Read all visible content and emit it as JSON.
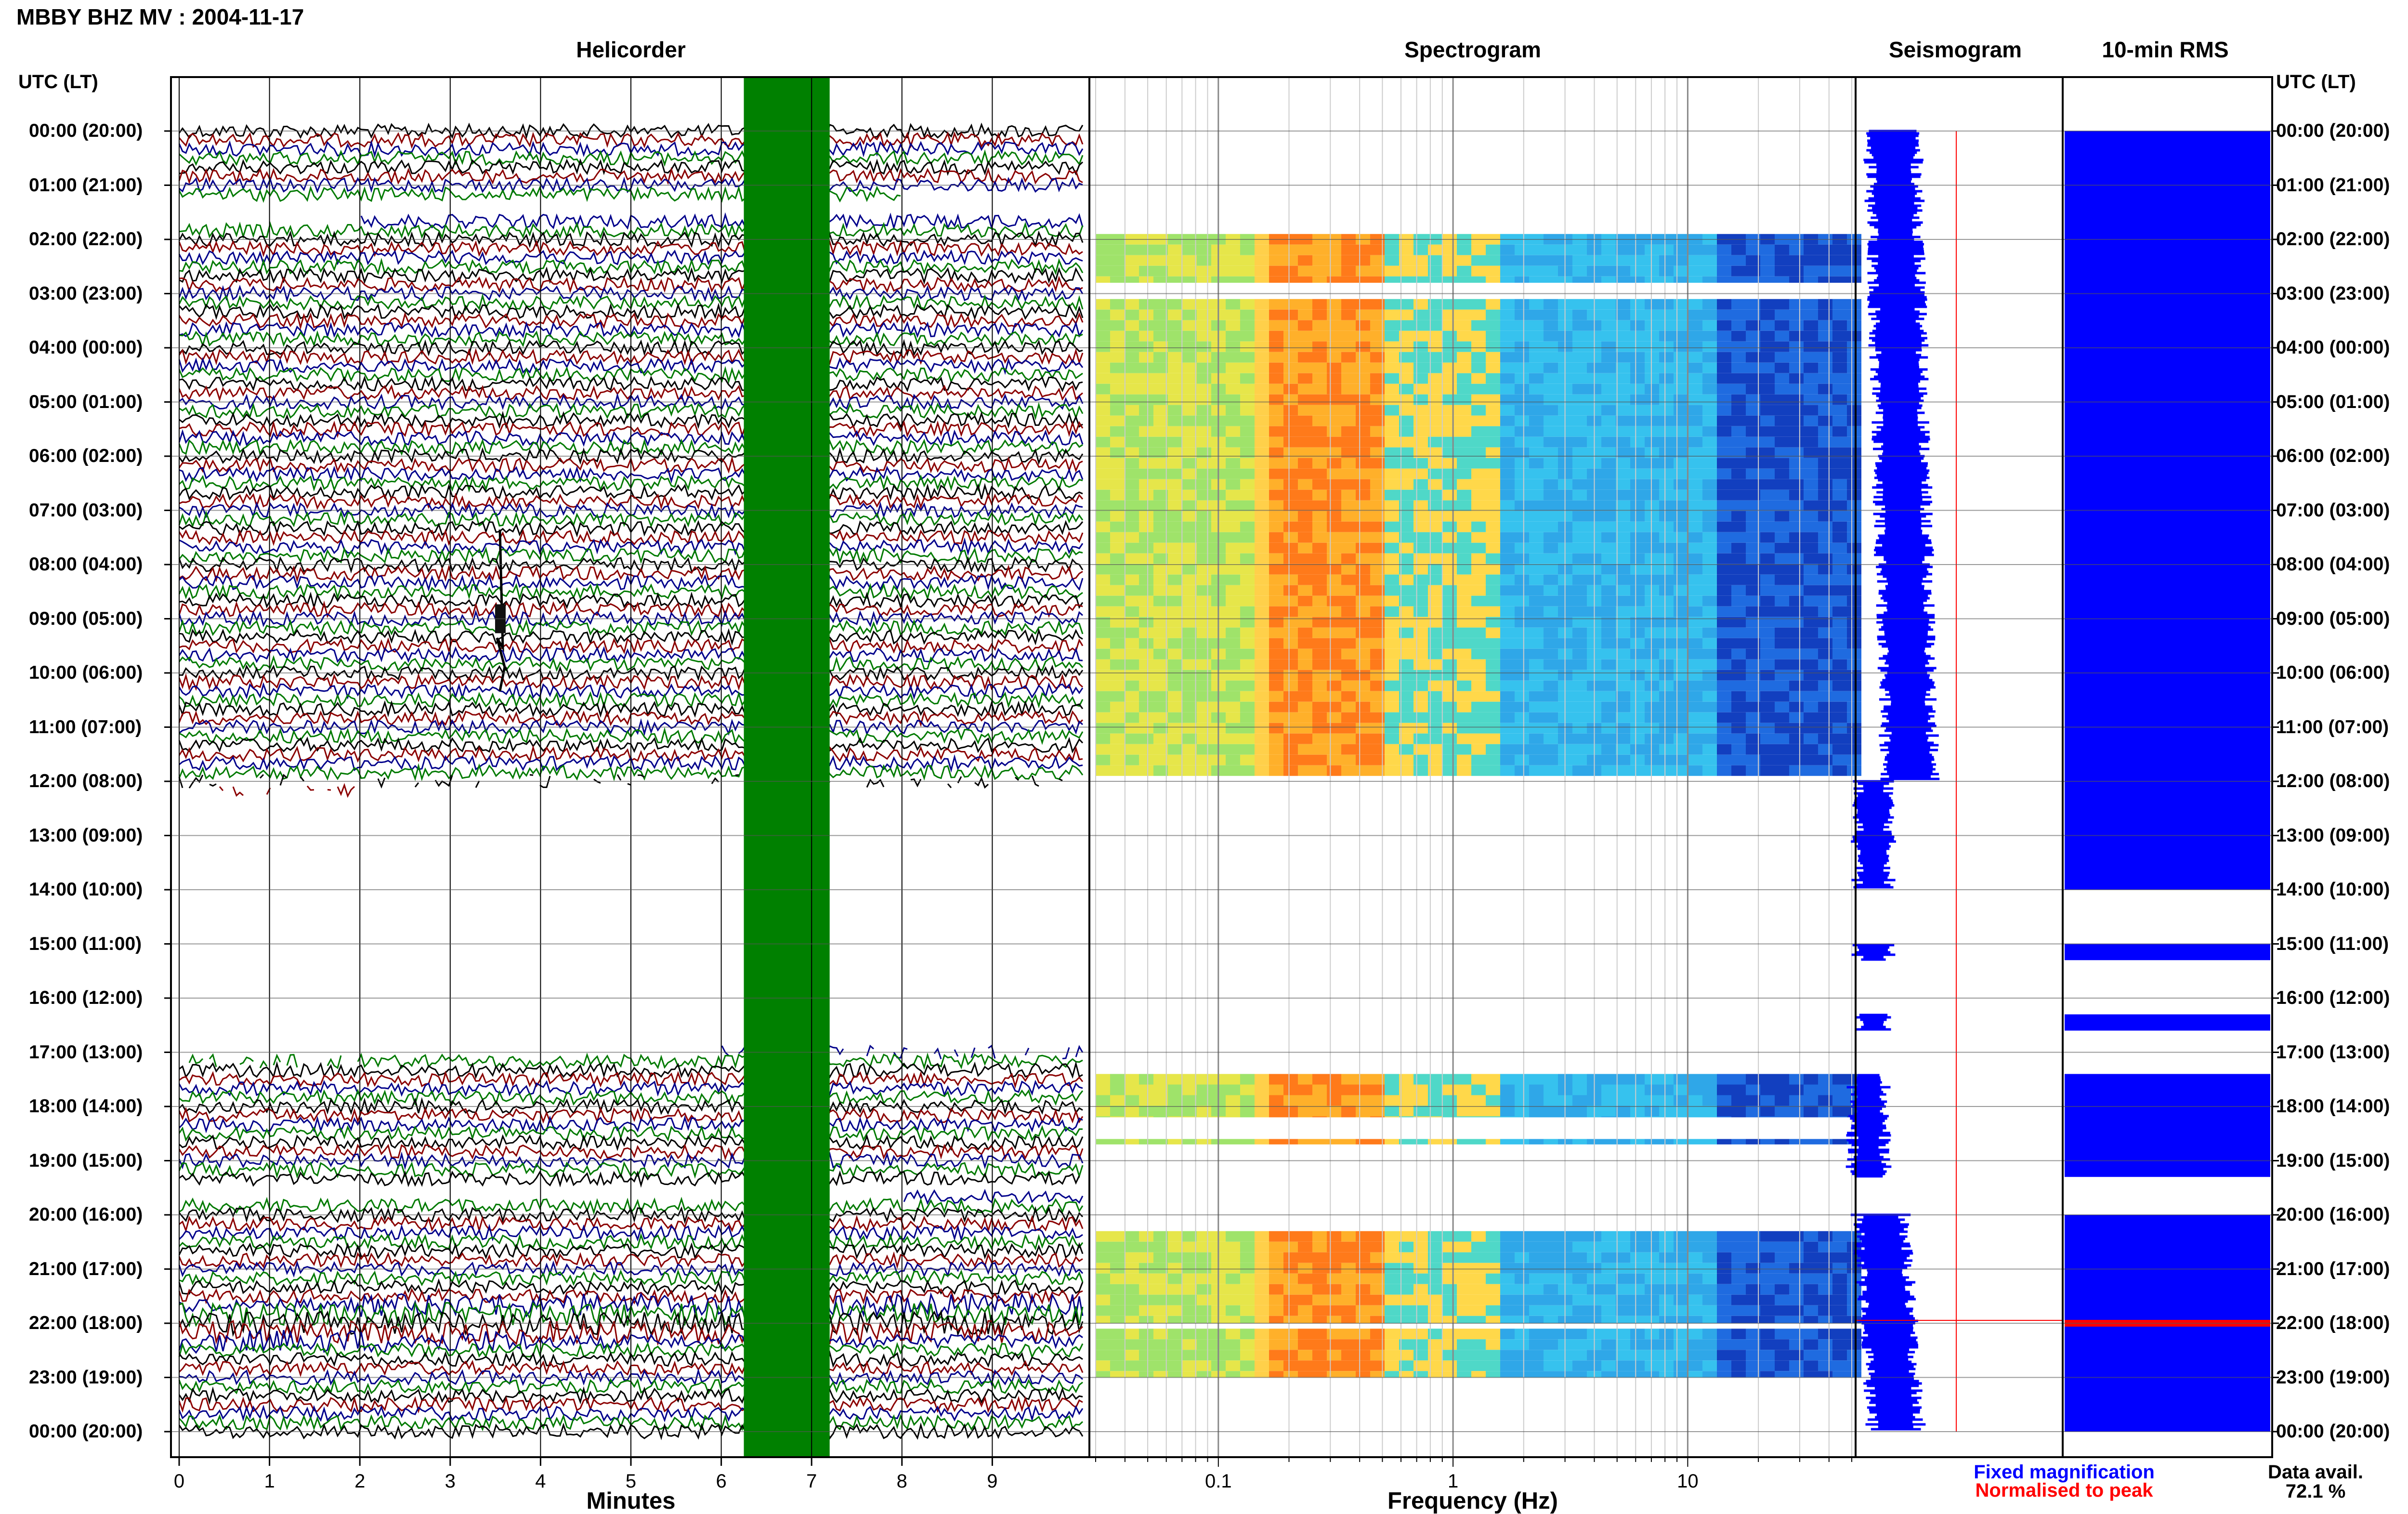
{
  "header": {
    "title": "MBBY BHZ MV : 2004-11-17"
  },
  "panels": {
    "helicorder": "Helicorder",
    "spectrogram": "Spectrogram",
    "seismogram": "Seismogram",
    "rms": "10-min RMS"
  },
  "axis": {
    "utc_label_left": "UTC (LT)",
    "utc_label_right": "UTC (LT)",
    "minutes_title": "Minutes",
    "frequency_title": "Frequency (Hz)"
  },
  "legend": {
    "fixed": "Fixed magnification",
    "normalised": "Normalised to peak",
    "avail_label": "Data avail.",
    "avail_value": "72.1 %"
  },
  "colors": {
    "trace_cycle": [
      "#000000",
      "#8b0000",
      "#00008b",
      "#007a00"
    ],
    "gap_band": "#008000",
    "fixed_mag": "#0000ff",
    "normalised": "#ff0000"
  },
  "chart_data": [
    {
      "type": "line",
      "title": "Helicorder",
      "xlabel": "Minutes",
      "x_ticks": [
        "0",
        "1",
        "2",
        "3",
        "4",
        "5",
        "6",
        "7",
        "8",
        "9"
      ],
      "xlim": [
        0,
        10
      ],
      "row_labels": [
        "00:00 (20:00)",
        "01:00 (21:00)",
        "02:00 (22:00)",
        "03:00 (23:00)",
        "04:00 (00:00)",
        "05:00 (01:00)",
        "06:00 (02:00)",
        "07:00 (03:00)",
        "08:00 (04:00)",
        "09:00 (05:00)",
        "10:00 (06:00)",
        "11:00 (07:00)",
        "12:00 (08:00)",
        "13:00 (09:00)",
        "14:00 (10:00)",
        "15:00 (11:00)",
        "16:00 (12:00)",
        "17:00 (13:00)",
        "18:00 (14:00)",
        "19:00 (15:00)",
        "20:00 (16:00)",
        "21:00 (17:00)",
        "22:00 (18:00)",
        "23:00 (19:00)",
        "00:00 (20:00)"
      ],
      "traces_per_hour": 6,
      "data_gaps_utc_hours": [
        [
          1.3,
          1.7
        ],
        [
          12.2,
          17.1
        ],
        [
          19.5,
          19.8
        ]
      ],
      "gap_band_minutes": [
        6.25,
        7.2
      ],
      "event_utc_hour": 9.0,
      "event_minute": 3.55
    },
    {
      "type": "heatmap",
      "title": "Spectrogram",
      "xlabel": "Frequency (Hz)",
      "x_scale": "log",
      "x_ticks": [
        "0.1",
        "1",
        "10"
      ],
      "xlim": [
        0.03,
        50
      ],
      "data_blocks_utc_hours": [
        [
          1.9,
          2.8
        ],
        [
          3.1,
          11.9
        ],
        [
          17.4,
          18.2
        ],
        [
          18.6,
          18.7
        ],
        [
          20.3,
          22.0
        ],
        [
          22.1,
          23.0
        ]
      ],
      "peak_band_hz": [
        0.15,
        0.45
      ]
    },
    {
      "type": "area",
      "title": "Seismogram",
      "series": [
        {
          "name": "Fixed magnification",
          "color": "#0000ff"
        },
        {
          "name": "Normalised to peak",
          "color": "#ff0000"
        }
      ]
    },
    {
      "type": "bar",
      "title": "10-min RMS",
      "data_blocks_utc_hours": [
        [
          0.0,
          14.0
        ],
        [
          15.0,
          15.3
        ],
        [
          16.3,
          16.6
        ],
        [
          17.4,
          19.3
        ],
        [
          20.0,
          24.0
        ]
      ],
      "highlight_utc_hour": 22.0
    }
  ]
}
